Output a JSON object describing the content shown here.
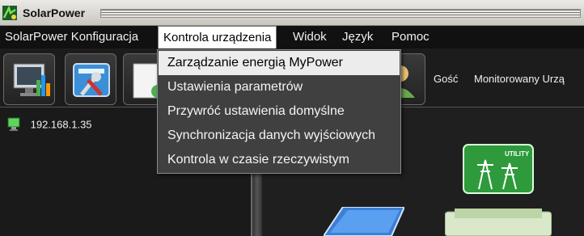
{
  "window": {
    "title": "SolarPower"
  },
  "menubar": {
    "items": [
      {
        "label": "SolarPower Konfiguracja"
      },
      {
        "label": "Kontrola urządzenia"
      },
      {
        "label": "Widok"
      },
      {
        "label": "Język"
      },
      {
        "label": "Pomoc"
      }
    ]
  },
  "dropdown": {
    "items": [
      {
        "label": "Zarządzanie energią MyPower"
      },
      {
        "label": "Ustawienia parametrów"
      },
      {
        "label": "Przywróć ustawienia domyślne"
      },
      {
        "label": "Synchronizacja danych wyjściowych"
      },
      {
        "label": "Kontrola w czasie rzeczywistym"
      }
    ]
  },
  "toolbar": {
    "user": "Gość",
    "monitored": "Monitorowany Urzą"
  },
  "tree": {
    "node": "192.168.1.35"
  },
  "diagram": {
    "utility_label": "UTILITY"
  },
  "colors": {
    "accent_green": "#2e9a3c",
    "highlight": "#ececec"
  }
}
